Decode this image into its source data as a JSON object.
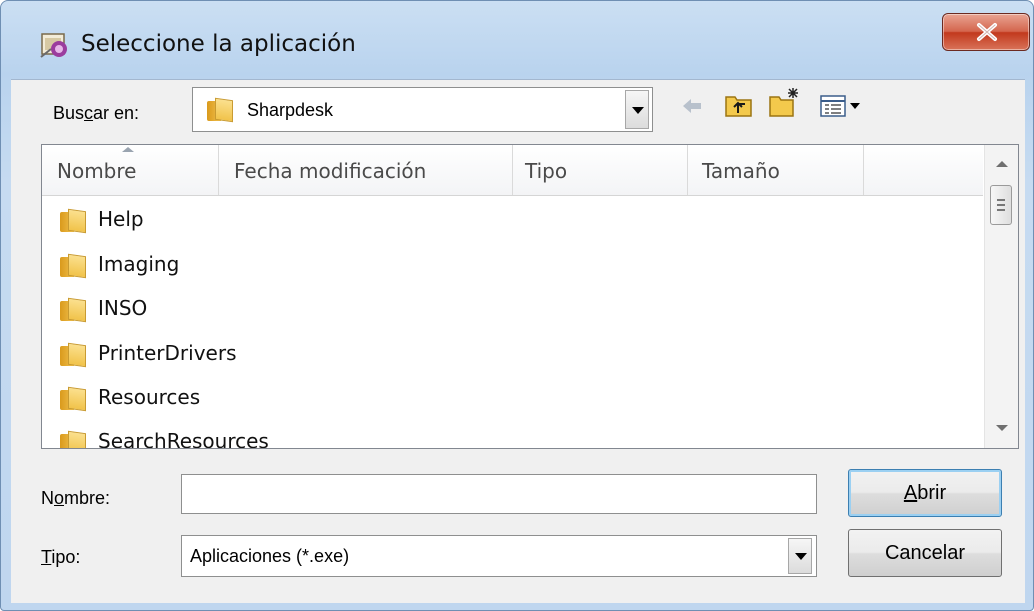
{
  "window": {
    "title": "Seleccione la aplicación",
    "icon": "app-wizard-icon",
    "close_icon": "close-icon"
  },
  "lookin": {
    "label_pre": "Bus",
    "label_accel": "c",
    "label_post": "ar en:",
    "value": "Sharpdesk"
  },
  "toolbar": {
    "icons": [
      "back-arrow-icon",
      "up-folder-icon",
      "new-folder-icon",
      "view-menu-icon"
    ]
  },
  "list": {
    "columns": [
      "Nombre",
      "Fecha modificación",
      "Tipo",
      "Tamaño"
    ],
    "items": [
      {
        "name": "Help"
      },
      {
        "name": "Imaging"
      },
      {
        "name": "INSO"
      },
      {
        "name": "PrinterDrivers"
      },
      {
        "name": "Resources"
      },
      {
        "name": "SearchResources"
      }
    ]
  },
  "filename": {
    "label_pre": "N",
    "label_accel": "o",
    "label_post": "mbre:",
    "value": ""
  },
  "filetype": {
    "label_accel": "T",
    "label_post": "ipo:",
    "value": "Aplicaciones (*.exe)"
  },
  "buttons": {
    "open_accel": "A",
    "open_post": "brir",
    "cancel": "Cancelar"
  }
}
